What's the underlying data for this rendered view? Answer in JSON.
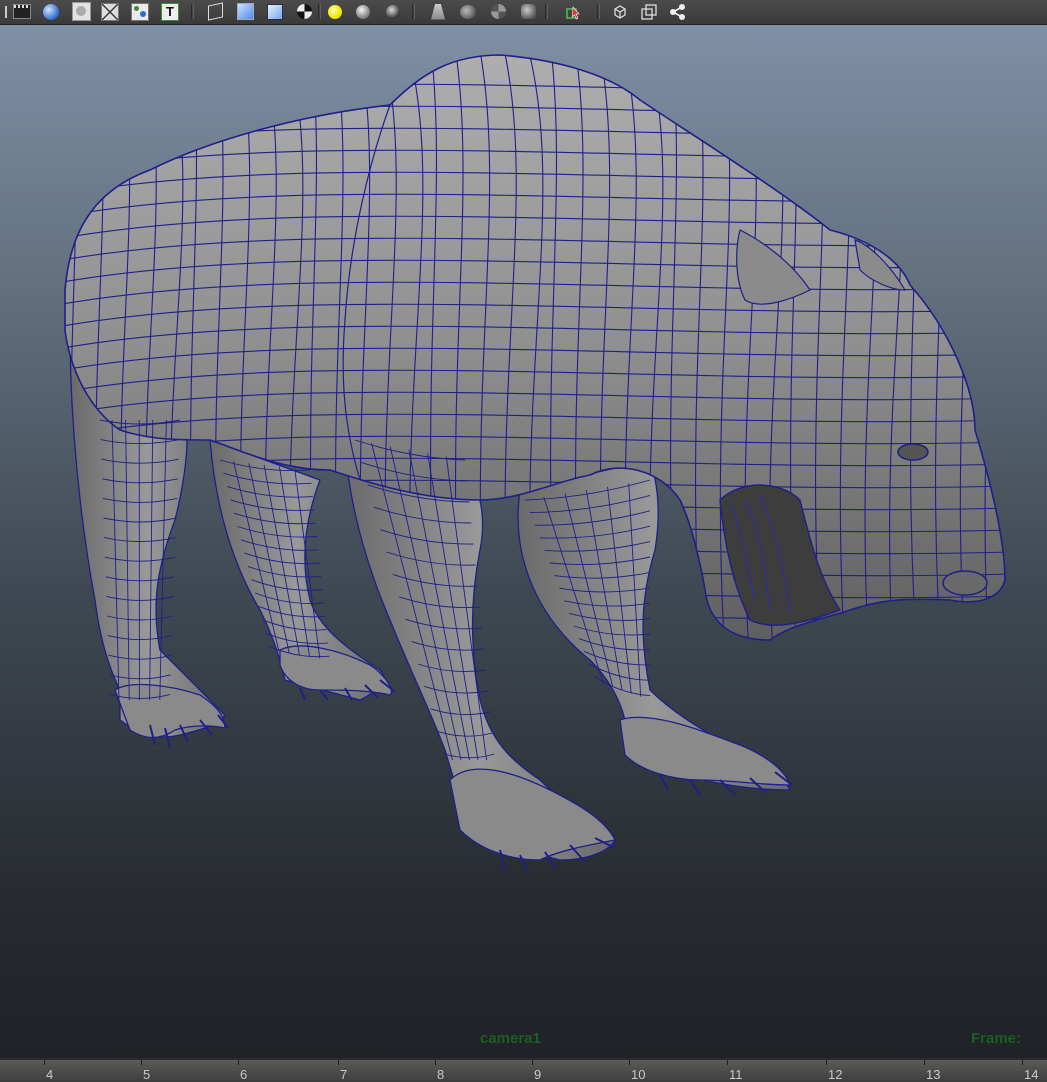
{
  "toolbar": {
    "buttons": [
      {
        "icon": "film-icon"
      },
      {
        "icon": "smooth-shade-all-icon"
      },
      {
        "icon": "flat-shade-icon"
      },
      {
        "icon": "wireframe-on-shaded-icon"
      },
      {
        "icon": "textured-icon"
      },
      {
        "icon": "text-icon",
        "label": "T"
      },
      {
        "icon": "wireframe-cube-icon"
      },
      {
        "icon": "shaded-cube-icon"
      },
      {
        "icon": "xray-cube-icon"
      },
      {
        "icon": "checker-icon"
      },
      {
        "icon": "default-light-icon"
      },
      {
        "icon": "all-lights-icon"
      },
      {
        "icon": "shadows-icon"
      },
      {
        "icon": "ambient-occlusion-icon"
      },
      {
        "icon": "motion-blur-icon"
      },
      {
        "icon": "anti-alias-icon"
      },
      {
        "icon": "depth-of-field-icon"
      },
      {
        "icon": "isolate-select-icon"
      },
      {
        "icon": "xray-icon"
      },
      {
        "icon": "xray-joints-icon"
      },
      {
        "icon": "share-icon"
      }
    ]
  },
  "viewport": {
    "camera_label": "camera1",
    "frame_label": "Frame:",
    "hud_color": "#1d5e25",
    "wire_color": "#1f1f8a"
  },
  "timeline": {
    "ticks": [
      "4",
      "5",
      "6",
      "7",
      "8",
      "9",
      "10",
      "11",
      "12",
      "13",
      "14"
    ]
  }
}
